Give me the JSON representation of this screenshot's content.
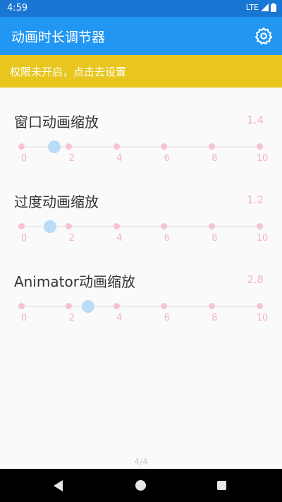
{
  "status_bar": {
    "time": "4:59",
    "network": "LTE"
  },
  "app_bar": {
    "title": "动画时长调节器",
    "settings_icon": "gear-icon"
  },
  "banner": {
    "text": "权限未开启，点击去设置"
  },
  "sliders": [
    {
      "title": "窗口动画缩放",
      "value_label": "1.4",
      "value": 1.4
    },
    {
      "title": "过度动画缩放",
      "value_label": "1.2",
      "value": 1.2
    },
    {
      "title": "Animator动画缩放",
      "value_label": "2.8",
      "value": 2.8
    }
  ],
  "slider_scale": {
    "min": 0,
    "max": 10,
    "ticks": [
      "0",
      "2",
      "4",
      "6",
      "8",
      "10"
    ]
  },
  "colors": {
    "primary": "#2196f3",
    "primary_dark": "#1976d2",
    "banner": "#e8c61e",
    "tick": "#f7c2d1",
    "value_text": "#f4b3c2",
    "thumb": "#b9dcf7"
  },
  "page_indicator": "4/4",
  "nav_bar": {
    "back": "back-icon",
    "home": "home-icon",
    "recents": "recents-icon"
  }
}
